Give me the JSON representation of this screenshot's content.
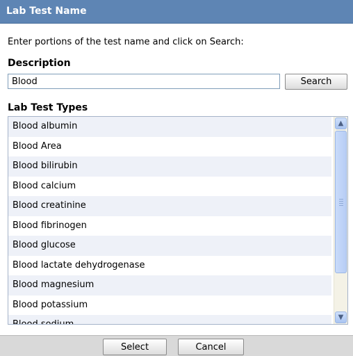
{
  "dialog": {
    "title": "Lab Test Name"
  },
  "instructions": "Enter portions of the test name and click on Search:",
  "description": {
    "label": "Description",
    "value": "Blood",
    "search_label": "Search"
  },
  "lab_test_types": {
    "label": "Lab Test Types",
    "items": [
      "Blood albumin",
      "Blood Area",
      "Blood bilirubin",
      "Blood calcium",
      "Blood creatinine",
      "Blood fibrinogen",
      "Blood glucose",
      "Blood lactate dehydrogenase",
      "Blood magnesium",
      "Blood potassium",
      "Blood sodium"
    ]
  },
  "footer": {
    "select_label": "Select",
    "cancel_label": "Cancel"
  },
  "icons": {
    "scroll_up": "chevron-up-icon",
    "scroll_down": "chevron-down-icon"
  },
  "colors": {
    "title_bar": "#5e85b4",
    "row_alt": "#eef1f8",
    "footer": "#d9d9d9"
  }
}
